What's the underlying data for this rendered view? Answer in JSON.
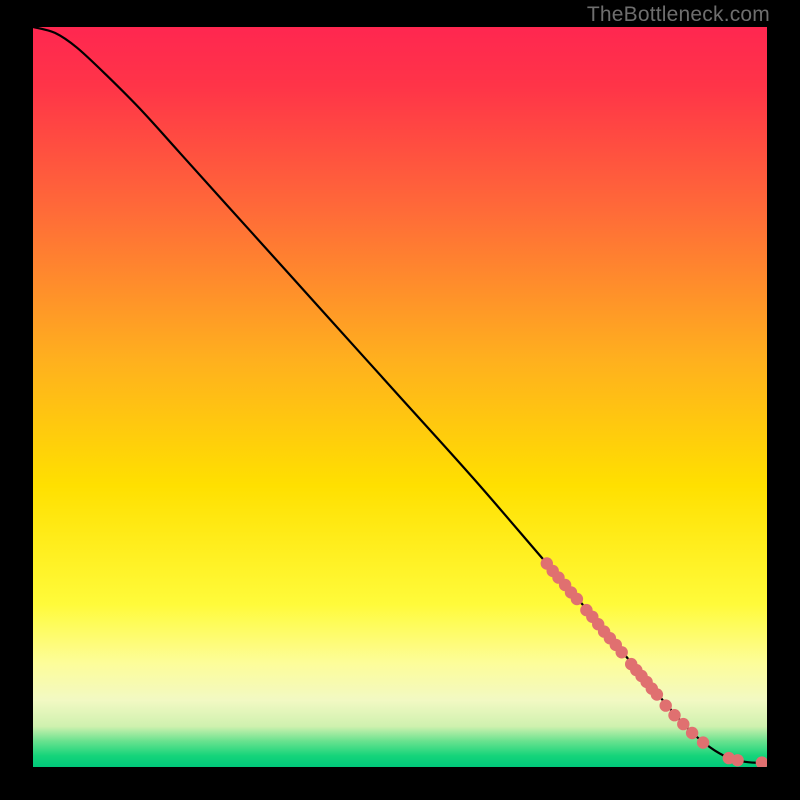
{
  "watermark": "TheBottleneck.com",
  "chart_data": {
    "type": "line",
    "title": "",
    "xlabel": "",
    "ylabel": "",
    "xlim": [
      0,
      100
    ],
    "ylim": [
      0,
      100
    ],
    "grid": false,
    "gradient_stops": [
      {
        "offset": 0,
        "color": "#ff2750"
      },
      {
        "offset": 0.08,
        "color": "#ff3448"
      },
      {
        "offset": 0.25,
        "color": "#ff6b38"
      },
      {
        "offset": 0.45,
        "color": "#ffb01e"
      },
      {
        "offset": 0.62,
        "color": "#ffe000"
      },
      {
        "offset": 0.78,
        "color": "#fffb3a"
      },
      {
        "offset": 0.86,
        "color": "#fdfd9a"
      },
      {
        "offset": 0.91,
        "color": "#f2f9c3"
      },
      {
        "offset": 0.945,
        "color": "#cff1af"
      },
      {
        "offset": 0.965,
        "color": "#69e28f"
      },
      {
        "offset": 0.985,
        "color": "#15d47a"
      },
      {
        "offset": 1.0,
        "color": "#00c97a"
      }
    ],
    "series": [
      {
        "name": "curve",
        "stroke": "#000000",
        "x": [
          0,
          3,
          6,
          10,
          15,
          20,
          30,
          40,
          50,
          60,
          70,
          77,
          82,
          86,
          89,
          91.5,
          94,
          97,
          100
        ],
        "y": [
          100,
          99.2,
          97.2,
          93.5,
          88.5,
          83,
          72,
          61,
          50,
          39,
          27.5,
          19.5,
          13.5,
          8.8,
          5.4,
          3.2,
          1.6,
          0.7,
          0.55
        ]
      }
    ],
    "markers": {
      "color": "#e07070",
      "radius_pct": 0.85,
      "points": [
        {
          "x": 70.0,
          "y": 27.5
        },
        {
          "x": 70.8,
          "y": 26.5
        },
        {
          "x": 71.6,
          "y": 25.6
        },
        {
          "x": 72.5,
          "y": 24.6
        },
        {
          "x": 73.3,
          "y": 23.6
        },
        {
          "x": 74.1,
          "y": 22.7
        },
        {
          "x": 75.4,
          "y": 21.2
        },
        {
          "x": 76.2,
          "y": 20.3
        },
        {
          "x": 77.0,
          "y": 19.3
        },
        {
          "x": 77.8,
          "y": 18.3
        },
        {
          "x": 78.6,
          "y": 17.4
        },
        {
          "x": 79.4,
          "y": 16.5
        },
        {
          "x": 80.2,
          "y": 15.5
        },
        {
          "x": 81.5,
          "y": 13.9
        },
        {
          "x": 82.2,
          "y": 13.1
        },
        {
          "x": 82.9,
          "y": 12.3
        },
        {
          "x": 83.6,
          "y": 11.5
        },
        {
          "x": 84.3,
          "y": 10.6
        },
        {
          "x": 85.0,
          "y": 9.8
        },
        {
          "x": 86.2,
          "y": 8.3
        },
        {
          "x": 87.4,
          "y": 7.0
        },
        {
          "x": 88.6,
          "y": 5.8
        },
        {
          "x": 89.8,
          "y": 4.6
        },
        {
          "x": 91.3,
          "y": 3.3
        },
        {
          "x": 94.8,
          "y": 1.2
        },
        {
          "x": 96.0,
          "y": 0.9
        },
        {
          "x": 99.3,
          "y": 0.6
        }
      ]
    }
  }
}
